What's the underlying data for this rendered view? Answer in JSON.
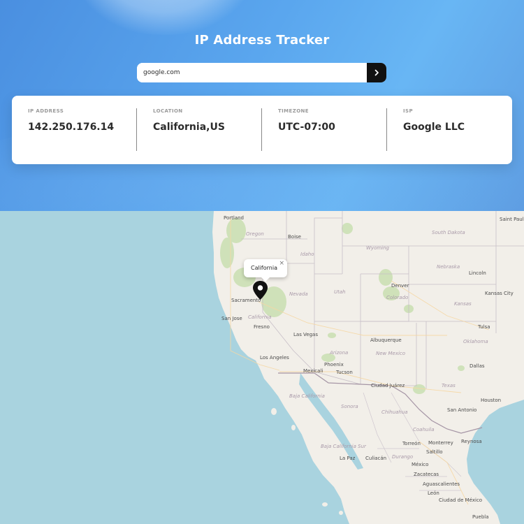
{
  "header": {
    "title": "IP Address Tracker"
  },
  "search": {
    "value": "google.com",
    "button_icon": "chevron-right-icon"
  },
  "info": {
    "ip": {
      "label": "IP ADDRESS",
      "value": "142.250.176.14"
    },
    "location": {
      "label": "LOCATION",
      "value": "California,US"
    },
    "timezone": {
      "label": "TIMEZONE",
      "value": "UTC-07:00"
    },
    "isp": {
      "label": "ISP",
      "value": "Google LLC"
    }
  },
  "map": {
    "popup": {
      "text": "California",
      "close": "×"
    },
    "marker_icon": "map-pin-icon",
    "cities": [
      "Portland",
      "Boise",
      "Saint Paul",
      "South Dakota",
      "Wyoming",
      "Nebraska",
      "Lincoln",
      "Sacramento",
      "California",
      "San Jose",
      "Utah",
      "Denver",
      "Colorado",
      "Kansas",
      "Kansas City",
      "Fresno",
      "Las Vegas",
      "Tulsa",
      "Oklahoma",
      "Arizona",
      "Albuquerque",
      "New Mexico",
      "Los Angeles",
      "Phoenix",
      "Dallas",
      "Mexicali",
      "Tucson",
      "Ciudad Juárez",
      "Baja California",
      "Sonora",
      "Chihuahua",
      "Texas",
      "San Antonio",
      "Houston",
      "Coahuila",
      "Torreón",
      "Monterrey",
      "Reynosa",
      "Baja California Sur",
      "La Paz",
      "Culiacán",
      "Durango",
      "Saltillo",
      "México",
      "Zacatecas",
      "Aguascalientes",
      "León",
      "Ciudad de México",
      "Puebla",
      "Oregon",
      "Idaho",
      "Nevada"
    ],
    "colors": {
      "water": "#a9d3df",
      "land": "#f2efe9",
      "forest": "#c9dfb1",
      "border": "#9aa0a6"
    }
  }
}
